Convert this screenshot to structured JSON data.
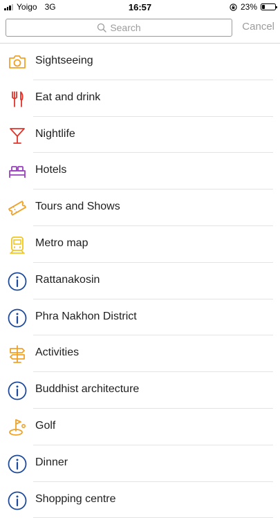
{
  "status_bar": {
    "carrier": "Yoigo",
    "network": "3G",
    "time": "16:57",
    "battery": "23%",
    "battery_level": 0.23
  },
  "search": {
    "placeholder": "Search",
    "cancel_label": "Cancel"
  },
  "colors": {
    "orange": "#f0a227",
    "red": "#e0342b",
    "purple": "#9b3fc0",
    "yellow": "#f2c61f",
    "blue": "#1e4a9a"
  },
  "categories": [
    {
      "label": "Sightseeing",
      "icon": "camera-icon",
      "color": "#f0a227"
    },
    {
      "label": "Eat and drink",
      "icon": "fork-knife-icon",
      "color": "#e0342b"
    },
    {
      "label": "Nightlife",
      "icon": "cocktail-glass-icon",
      "color": "#e0342b"
    },
    {
      "label": "Hotels",
      "icon": "bed-icon",
      "color": "#9b3fc0"
    },
    {
      "label": "Tours and Shows",
      "icon": "ticket-icon",
      "color": "#f0a227"
    },
    {
      "label": "Metro map",
      "icon": "train-icon",
      "color": "#f2c61f"
    },
    {
      "label": "Rattanakosin",
      "icon": "info-icon",
      "color": "#1e4a9a"
    },
    {
      "label": "Phra Nakhon District",
      "icon": "info-icon",
      "color": "#1e4a9a"
    },
    {
      "label": "Activities",
      "icon": "signpost-icon",
      "color": "#f0a227"
    },
    {
      "label": "Buddhist architecture",
      "icon": "info-icon",
      "color": "#1e4a9a"
    },
    {
      "label": "Golf",
      "icon": "golf-icon",
      "color": "#f0a227"
    },
    {
      "label": "Dinner",
      "icon": "info-icon",
      "color": "#1e4a9a"
    },
    {
      "label": "Shopping centre",
      "icon": "info-icon",
      "color": "#1e4a9a"
    }
  ]
}
